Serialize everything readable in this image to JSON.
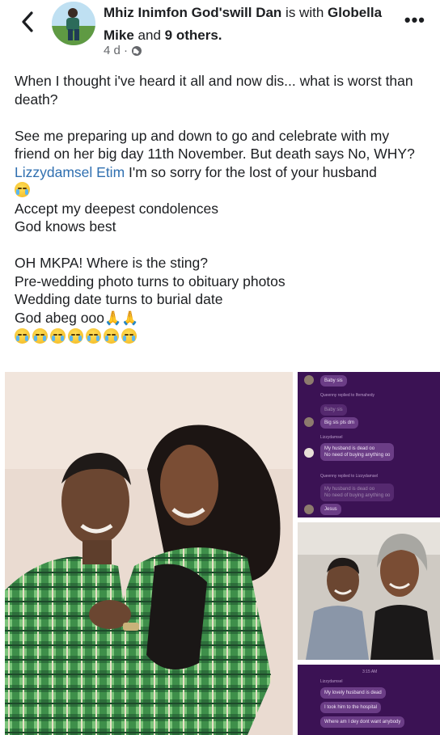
{
  "header": {
    "author_name": "Mhiz Inimfon God'swill Dan",
    "with_text": "is with",
    "tagged_name": "Globella Mike",
    "and_text": "and",
    "others_text": "9 others.",
    "time": "4 d ·",
    "back_icon": "chevron-left-icon",
    "privacy_icon": "globe-icon",
    "more_icon": "more-horizontal-icon"
  },
  "post": {
    "line1": "When I thought i've heard it all and now dis... what is worst than death?",
    "line2": "See me preparing up and down to go and celebrate with my friend on her big day 11th November. But death says No, WHY?",
    "mention": "Lizzydamsel Etim",
    "mention_rest": " I'm so sorry for the lost of your husband",
    "line4": "Accept my deepest condolences",
    "line5": "God knows best",
    "line6": "OH MKPA! Where is the sting?",
    "line7": "Pre-wedding photo turns to obituary photos",
    "line8": "Wedding date turns to burial date",
    "line9": "God abeg ooo",
    "emoji_name": "crying-face-emoji",
    "pray_name": "folded-hands-emoji"
  },
  "chat1": {
    "b1": "Baby sis",
    "s1": "Queenny replied to Ifemahedy",
    "b2": "Baby sis",
    "b3": "Big sis pls dm",
    "s2": "Lizzydamsel",
    "b4a": "My husband is dead oo",
    "b4b": "No need of buying anything oo",
    "s3": "Queenny replied to Lizzydamsel",
    "b5a": "My husband is dead oo",
    "b5b": "No need of buying anything oo",
    "b6": "Jesus"
  },
  "chat2": {
    "time": "3:15 AM",
    "name": "Lizzydamsel",
    "b1": "My lovely husband is dead",
    "b2": "I took him to the hospital",
    "b3": "Where am I dey dont want anybody"
  },
  "colors": {
    "mention": "#2f6fb0",
    "chat_bg": "#3b1254",
    "bubble": "#6b3d86"
  }
}
